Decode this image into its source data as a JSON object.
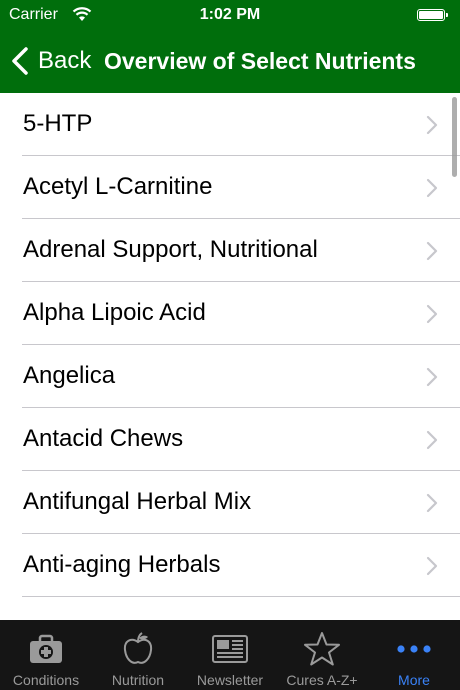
{
  "status_bar": {
    "carrier": "Carrier",
    "time": "1:02 PM"
  },
  "nav": {
    "back_label": "Back",
    "title": "Overview of Select Nutrients"
  },
  "list": {
    "items": [
      "5-HTP",
      "Acetyl L-Carnitine",
      "Adrenal Support, Nutritional",
      "Alpha Lipoic Acid",
      "Angelica",
      "Antacid Chews",
      "Antifungal Herbal Mix",
      "Anti-aging Herbals"
    ]
  },
  "tabbar": {
    "tabs": [
      {
        "label": "Conditions",
        "icon": "first-aid-kit-icon"
      },
      {
        "label": "Nutrition",
        "icon": "apple-icon"
      },
      {
        "label": "Newsletter",
        "icon": "newspaper-icon"
      },
      {
        "label": "Cures A-Z+",
        "icon": "star-icon"
      },
      {
        "label": "More",
        "icon": "more-dots-icon"
      }
    ],
    "active_index": 4
  },
  "colors": {
    "brand_green": "#006e0c",
    "tab_active": "#3a82f7",
    "tab_inactive": "#9a9a9a",
    "tabbar_bg": "#151515"
  }
}
